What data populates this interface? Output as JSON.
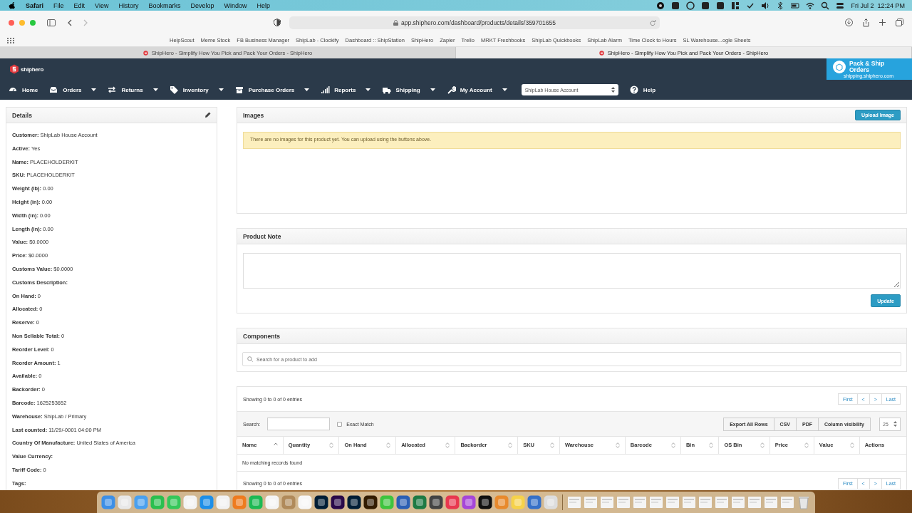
{
  "menu_bar": {
    "app": "Safari",
    "items": [
      "File",
      "Edit",
      "View",
      "History",
      "Bookmarks",
      "Develop",
      "Window",
      "Help"
    ],
    "clock": "Fri Jul 2  12:24 PM"
  },
  "browser": {
    "url": "app.shiphero.com/dashboard/products/details/359701655",
    "bookmarks": [
      "HelpScout",
      "Meme Stock",
      "FB Business Manager",
      "ShipLab - Clockify",
      "Dashboard :: ShipStation",
      "ShipHero",
      "Zapier",
      "Trello",
      "MRKT Freshbooks",
      "ShipLab Quickbooks",
      "ShipLab Alarm",
      "Time Clock to Hours",
      "SL Warehouse...ogle Sheets"
    ],
    "tabs": [
      {
        "title": "ShipHero - Simplify How You Pick and Pack Your Orders - ShipHero",
        "selected": false
      },
      {
        "title": "ShipHero - Simplify How You Pick and Pack Your Orders - ShipHero",
        "selected": true
      }
    ]
  },
  "header": {
    "logo": "shiphero",
    "promo": {
      "title": "Pack & Ship Orders",
      "subtitle": "shipping.shiphero.com"
    }
  },
  "nav": {
    "items": [
      {
        "label": "Home",
        "has_menu": false
      },
      {
        "label": "Orders",
        "has_menu": true
      },
      {
        "label": "Returns",
        "has_menu": true
      },
      {
        "label": "Inventory",
        "has_menu": true
      },
      {
        "label": "Purchase Orders",
        "has_menu": true
      },
      {
        "label": "Reports",
        "has_menu": true
      },
      {
        "label": "Shipping",
        "has_menu": true
      },
      {
        "label": "My Account",
        "has_menu": true
      }
    ],
    "account_select": "ShipLab House Account",
    "help": {
      "label": "Help"
    }
  },
  "details": {
    "title": "Details",
    "fields": [
      {
        "label": "Customer:",
        "value": "ShipLab House Account"
      },
      {
        "label": "Active:",
        "value": "Yes"
      },
      {
        "label": "Name:",
        "value": "PLACEHOLDERKIT"
      },
      {
        "label": "SKU:",
        "value": "PLACEHOLDERKIT"
      },
      {
        "label": "Weight (lb):",
        "value": "0.00"
      },
      {
        "label": "Height (in):",
        "value": "0.00"
      },
      {
        "label": "Width (in):",
        "value": "0.00"
      },
      {
        "label": "Length (in):",
        "value": "0.00"
      },
      {
        "label": "Value:",
        "value": "$0.0000"
      },
      {
        "label": "Price:",
        "value": "$0.0000"
      },
      {
        "label": "Customs Value:",
        "value": "$0.0000"
      },
      {
        "label": "Customs Description:"
      },
      {
        "label": "On Hand:",
        "value": "0"
      },
      {
        "label": "Allocated:",
        "value": "0"
      },
      {
        "label": "Reserve:",
        "value": "0"
      },
      {
        "label": "Non Sellable Total:",
        "value": "0"
      },
      {
        "label": "Reorder Level:",
        "value": "0"
      },
      {
        "label": "Reorder Amount:",
        "value": "1"
      },
      {
        "label": "Available:",
        "value": "0"
      },
      {
        "label": "Backorder:",
        "value": "0"
      },
      {
        "label": "Barcode:",
        "value": "1625253652"
      },
      {
        "label": "Warehouse:",
        "value": "ShipLab / Primary"
      },
      {
        "label": "Last counted:",
        "value": "11/29/-0001 04:00 PM"
      },
      {
        "label": "Country Of Manufacture:",
        "value": "United States of America"
      },
      {
        "label": "Value Currency:"
      },
      {
        "label": "Tariff Code:",
        "value": "0"
      },
      {
        "label": "Tags:"
      }
    ]
  },
  "images": {
    "title": "Images",
    "button": "Upload Image",
    "alert": "There are no images for this product yet. You can upload using the buttons above."
  },
  "product_note": {
    "title": "Product Note",
    "button": "Update"
  },
  "components": {
    "title": "Components",
    "search_placeholder": "Search for a product to add"
  },
  "table": {
    "info_top": "Showing 0 to 0 of 0 entries",
    "info_bottom": "Showing 0 to 0 of 0 entries",
    "pagination_top": [
      "First",
      "<",
      ">",
      "Last"
    ],
    "pagination_bottom": [
      "First",
      "<",
      ">",
      "Last"
    ],
    "search_label": "Search:",
    "exact_match": {
      "label": "Exact Match",
      "checked": false
    },
    "buttons": [
      "Export All Rows",
      "CSV",
      "PDF",
      "Column visibility"
    ],
    "page_size": "25",
    "columns": [
      {
        "label": "Name",
        "kind": "sortable",
        "sorted": true
      },
      {
        "label": "Quantity",
        "kind": "sortable",
        "sorted": false
      },
      {
        "label": "On Hand",
        "kind": "sortable",
        "sorted": false
      },
      {
        "label": "Allocated",
        "kind": "sortable",
        "sorted": false
      },
      {
        "label": "Backorder",
        "kind": "sortable",
        "sorted": false
      },
      {
        "label": "SKU",
        "kind": "sortable",
        "sorted": false
      },
      {
        "label": "Warehouse",
        "kind": "sortable",
        "sorted": false
      },
      {
        "label": "Barcode",
        "kind": "sortable",
        "sorted": false
      },
      {
        "label": "Bin",
        "kind": "sortable",
        "sorted": false
      },
      {
        "label": "OS Bin",
        "kind": "sortable",
        "sorted": false
      },
      {
        "label": "Price",
        "kind": "sortable",
        "sorted": false
      },
      {
        "label": "Value",
        "kind": "sortable",
        "sorted": false
      },
      {
        "label": "Actions",
        "kind": "plain"
      }
    ],
    "empty": "No matching records found"
  }
}
